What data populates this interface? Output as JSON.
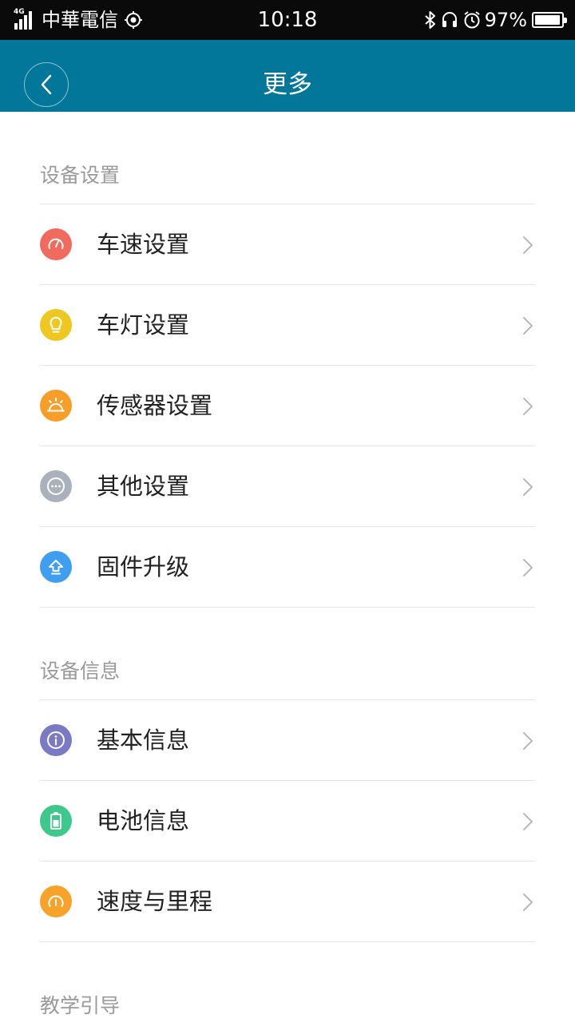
{
  "status_bar": {
    "network_type": "4G",
    "carrier": "中華電信",
    "time": "10:18",
    "battery_percent": "97%",
    "battery_level": 0.97
  },
  "nav": {
    "title": "更多"
  },
  "sections": [
    {
      "title": "设备设置",
      "items": [
        {
          "label": "车速设置",
          "icon": "speedometer-icon",
          "color": "#f06a5d"
        },
        {
          "label": "车灯设置",
          "icon": "bulb-icon",
          "color": "#eec821"
        },
        {
          "label": "传感器设置",
          "icon": "sensor-icon",
          "color": "#f79e28"
        },
        {
          "label": "其他设置",
          "icon": "more-dots-icon",
          "color": "#a9b2bc"
        },
        {
          "label": "固件升级",
          "icon": "upgrade-arrow-icon",
          "color": "#3f9ef0"
        }
      ]
    },
    {
      "title": "设备信息",
      "items": [
        {
          "label": "基本信息",
          "icon": "info-icon",
          "color": "#7a79c4"
        },
        {
          "label": "电池信息",
          "icon": "battery-icon",
          "color": "#3ec88c"
        },
        {
          "label": "速度与里程",
          "icon": "gauge-icon",
          "color": "#f7a32a"
        }
      ]
    },
    {
      "title": "教学引导",
      "items": []
    }
  ]
}
